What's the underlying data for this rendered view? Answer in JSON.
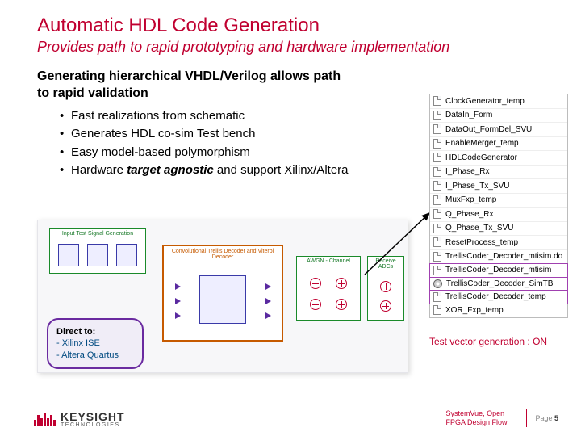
{
  "title": "Automatic HDL Code Generation",
  "subtitle": "Provides path to rapid prototyping and hardware implementation",
  "lead": "Generating hierarchical VHDL/Verilog allows path to rapid validation",
  "bullets": [
    "Fast realizations from schematic",
    "Generates HDL co-sim Test bench",
    "Easy model-based polymorphism"
  ],
  "bullet4_a": "Hardware ",
  "bullet4_b": "target agnostic",
  "bullet4_c": " and support Xilinx/Altera",
  "callout": {
    "head": "Direct to:",
    "l1": "- Xilinx ISE",
    "l2": "- Altera Quartus"
  },
  "diagram": {
    "box1": "Input Test Signal Generation",
    "box2": "Convolutional Trellis Decoder and Viterbi Decoder",
    "box3": "AWGN - Channel",
    "box4": "Receive ADCs"
  },
  "files": [
    {
      "name": "ClockGenerator_temp",
      "icon": "file"
    },
    {
      "name": "DataIn_Form",
      "icon": "file"
    },
    {
      "name": "DataOut_FormDel_SVU",
      "icon": "file"
    },
    {
      "name": "EnableMerger_temp",
      "icon": "file"
    },
    {
      "name": "HDLCodeGenerator",
      "icon": "file"
    },
    {
      "name": "I_Phase_Rx",
      "icon": "file"
    },
    {
      "name": "I_Phase_Tx_SVU",
      "icon": "file"
    },
    {
      "name": "MuxFxp_temp",
      "icon": "file"
    },
    {
      "name": "Q_Phase_Rx",
      "icon": "file"
    },
    {
      "name": "Q_Phase_Tx_SVU",
      "icon": "file"
    },
    {
      "name": "ResetProcess_temp",
      "icon": "file"
    },
    {
      "name": "TrellisCoder_Decoder_mtisim.do",
      "icon": "file"
    },
    {
      "name": "TrellisCoder_Decoder_mtisim",
      "icon": "file",
      "hl": true
    },
    {
      "name": "TrellisCoder_Decoder_SimTB",
      "icon": "gear",
      "hl": true
    },
    {
      "name": "TrellisCoder_Decoder_temp",
      "icon": "file",
      "hl": true
    },
    {
      "name": "XOR_Fxp_temp",
      "icon": "file"
    }
  ],
  "tv": "Test vector generation : ON",
  "footer": {
    "brand_top": "KEYSIGHT",
    "brand_bot": "TECHNOLOGIES",
    "meta": "SystemVue, Open FPGA Design Flow",
    "page_label": "Page ",
    "page_num": "5"
  }
}
